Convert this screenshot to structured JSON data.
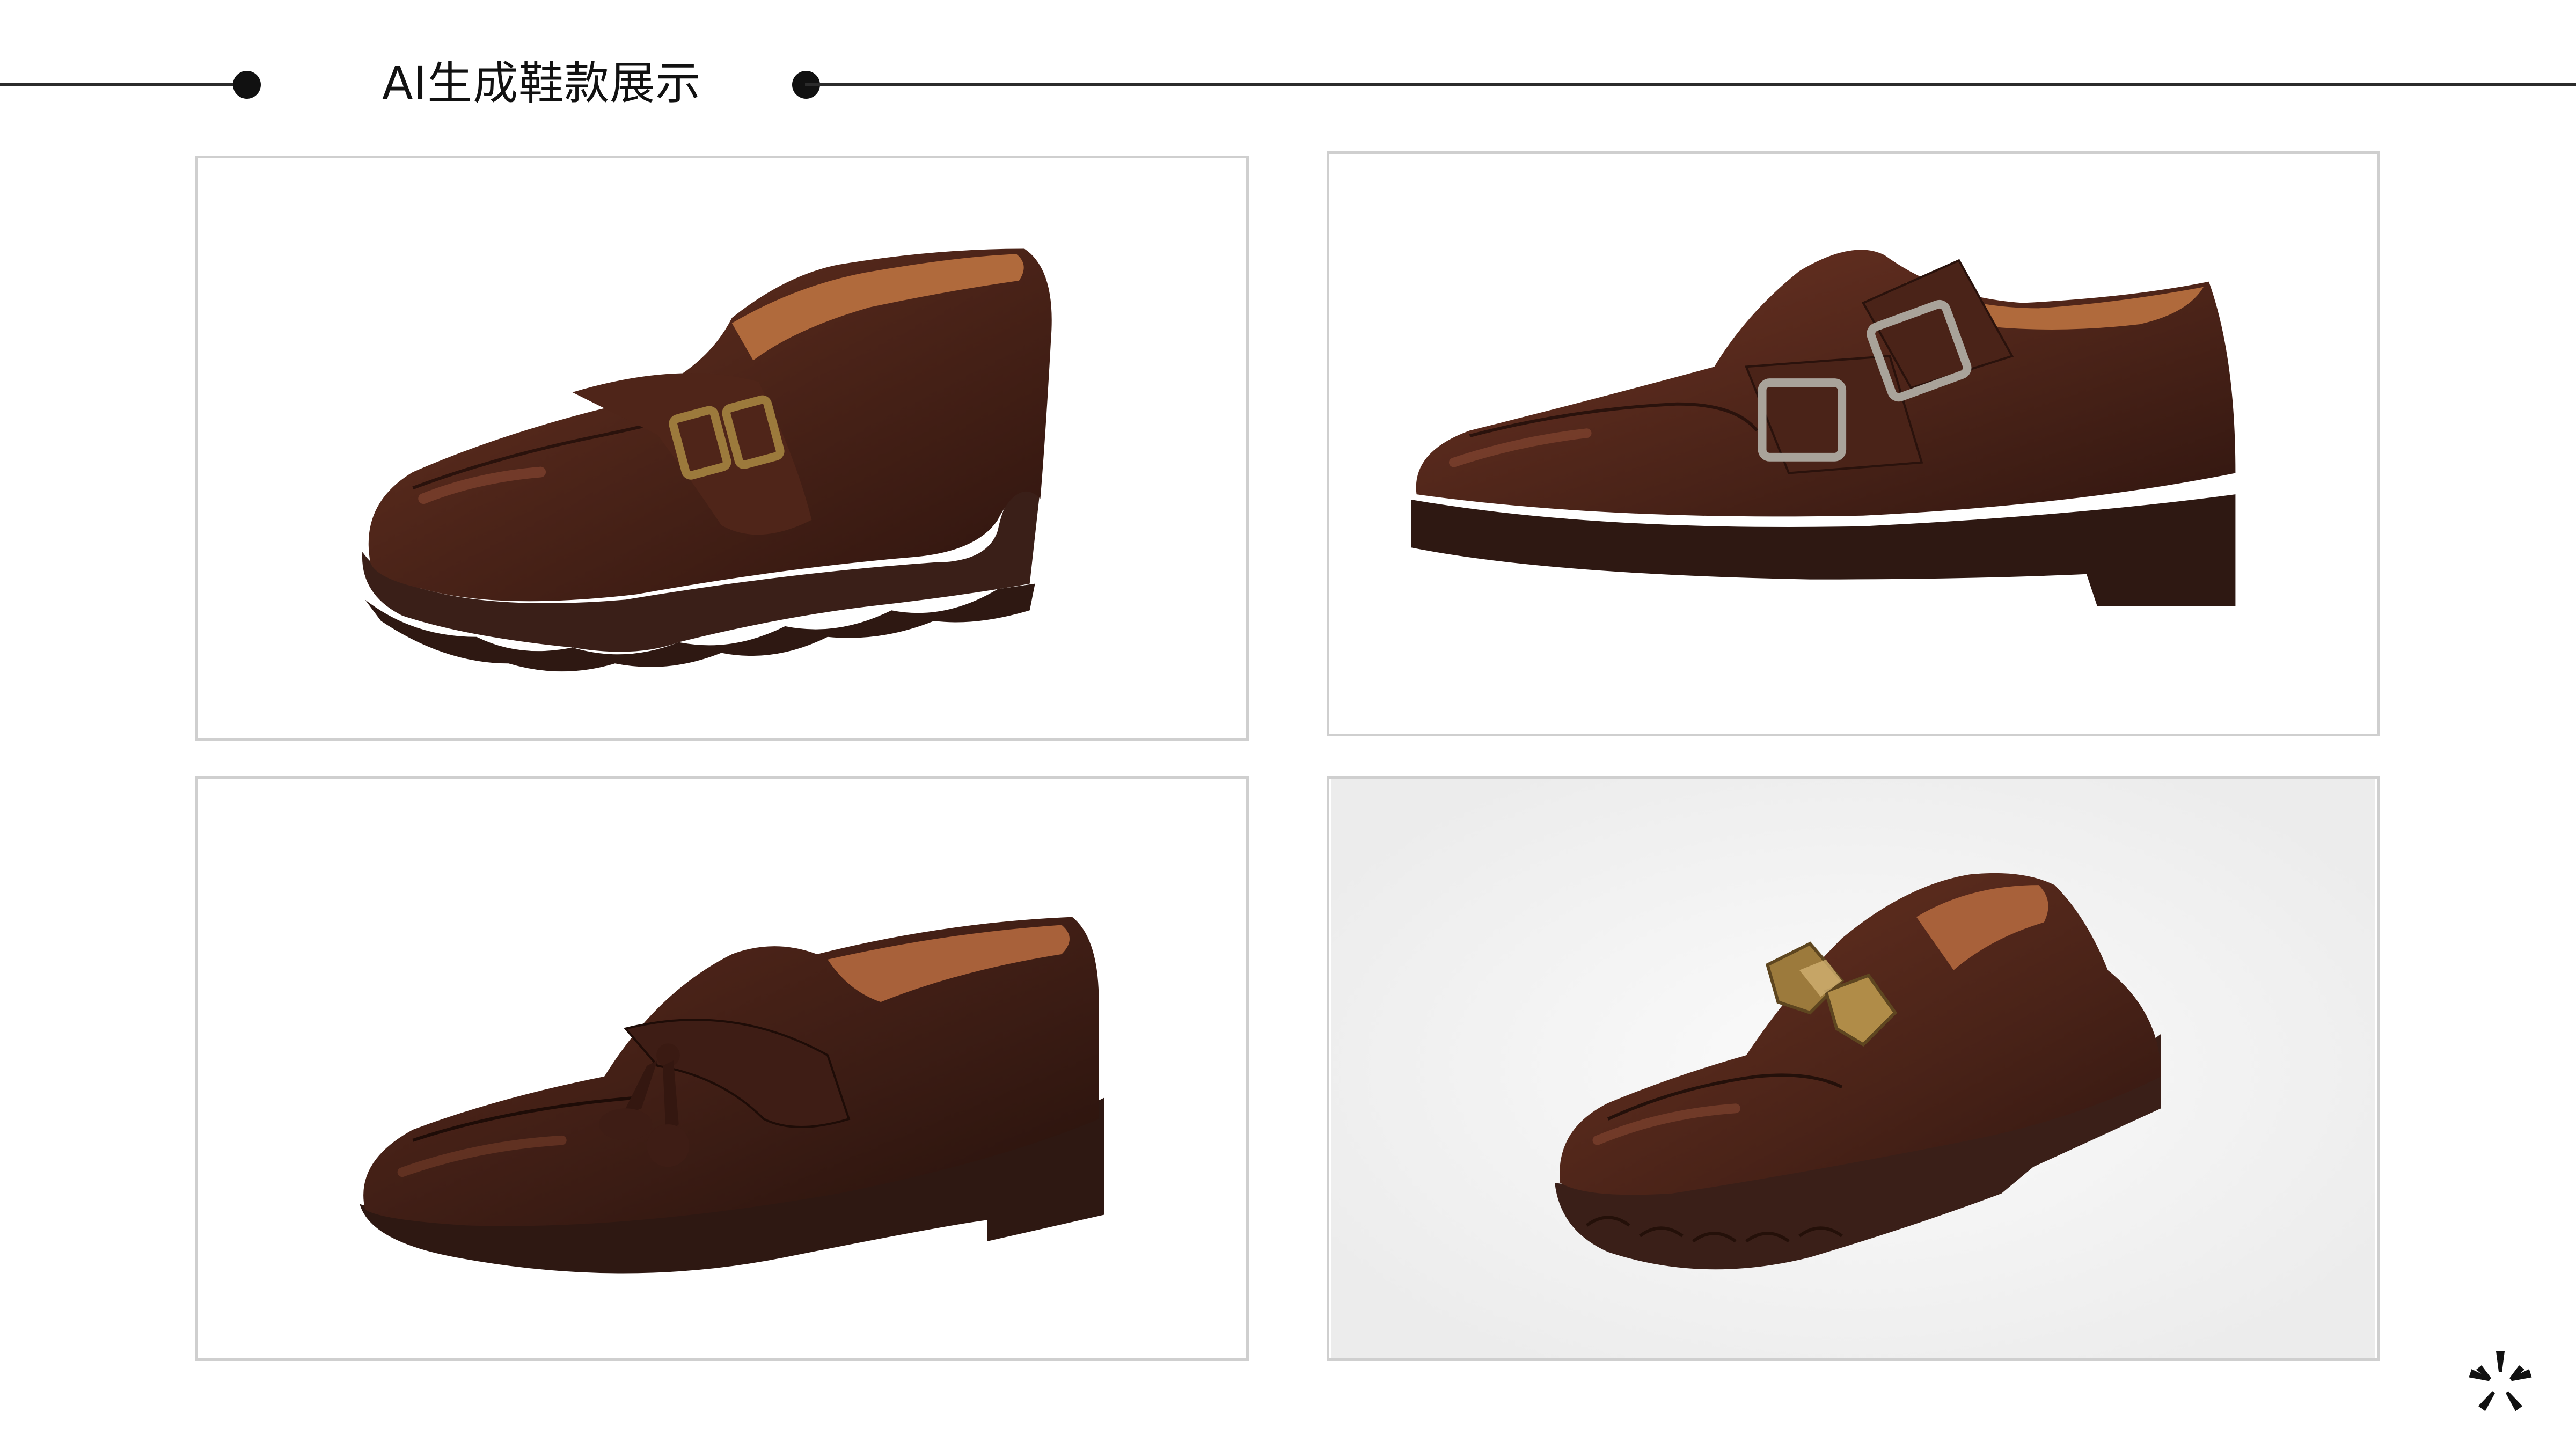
{
  "slide": {
    "title": "AI生成鞋款展示"
  },
  "images": [
    {
      "icon": "buckle-loafer-shoe-icon",
      "description_color": "#4a2318"
    },
    {
      "icon": "double-monk-strap-shoe-icon",
      "description_color": "#4a2318"
    },
    {
      "icon": "tassel-loafer-shoe-icon",
      "description_color": "#3b1e16"
    },
    {
      "icon": "ornament-lug-loafer-shoe-icon",
      "description_color": "#4a2318"
    }
  ],
  "colors": {
    "leather_dark": "#3b1c14",
    "leather_mid": "#5a2a1c",
    "leather_highlight": "#8a4a34",
    "lining_tan": "#b06a3c",
    "sole": "#3a1f18",
    "brass": "#9c7a3c",
    "steel": "#a9a39a",
    "rule": "#2b2b2b",
    "card_border": "#cfcfcf"
  }
}
